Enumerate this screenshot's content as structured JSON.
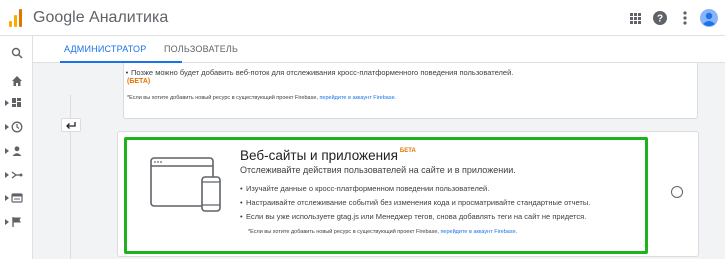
{
  "app": {
    "title": "Google Аналитика"
  },
  "colors": {
    "accent": "#1a73e8",
    "beta": "#e37400",
    "highlight": "#1db31d",
    "logo": "#f9ab00"
  },
  "topbar_icons": [
    "apps-grid-icon",
    "help-icon",
    "more-vert-icon",
    "account-avatar-icon"
  ],
  "tabs": [
    {
      "label": "АДМИНИСТРАТОР",
      "active": true
    },
    {
      "label": "ПОЛЬЗОВАТЕЛЬ",
      "active": false
    }
  ],
  "sidebar_icons": [
    "search-icon",
    "home-icon",
    "dashboard-icon",
    "clock-icon",
    "person-icon",
    "acquisition-icon",
    "behavior-icon",
    "flag-icon"
  ],
  "top_card": {
    "bullet": "Позже можно будет добавить веб-поток для отслеживания кросс-платформенного поведения пользователей.",
    "beta": "(БЕТА)",
    "note": "*Если вы хотите добавить новый ресурс в существующий проект Firebase, ",
    "note_link": "перейдите в аккаунт Firebase."
  },
  "main_card": {
    "title": "Веб-сайты и приложения",
    "beta": "БЕТА",
    "subtitle": "Отслеживайте действия пользователей на сайте и в приложении.",
    "bullets": [
      "Изучайте данные о кросс-платформенном поведении пользователей.",
      "Настраивайте отслеживание событий без изменения кода и просматривайте стандартные отчеты.",
      "Если вы уже используете gtag.js или Менеджер тегов, снова добавлять теги на сайт не придется."
    ],
    "note": "*Если вы хотите добавить новый ресурс в существующий проект Firebase, ",
    "note_link": "перейдите в аккаунт Firebase."
  }
}
